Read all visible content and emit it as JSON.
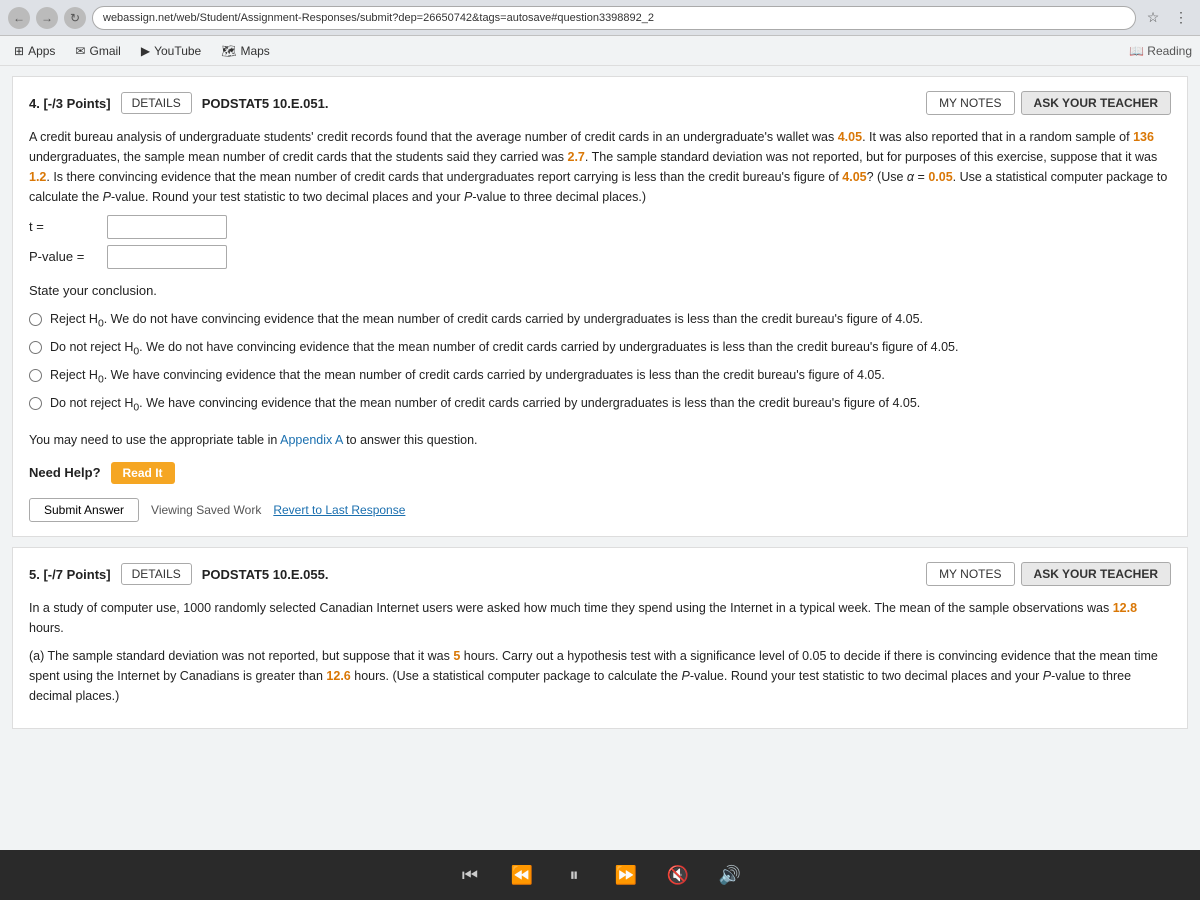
{
  "browser": {
    "url": "webassign.net/web/Student/Assignment-Responses/submit?dep=26650742&tags=autosave#question3398892_2",
    "bookmarks": [
      {
        "id": "apps",
        "label": "Apps",
        "icon": "⊞"
      },
      {
        "id": "gmail",
        "label": "Gmail",
        "icon": "✉"
      },
      {
        "id": "youtube",
        "label": "YouTube",
        "icon": "▶"
      },
      {
        "id": "maps",
        "label": "Maps",
        "icon": "🗺"
      }
    ],
    "bookmarks_right": "Reading"
  },
  "question4": {
    "points_label": "4. [-/3 Points]",
    "details_label": "DETAILS",
    "podstat_label": "PODSTAT5 10.E.051.",
    "my_notes_label": "MY NOTES",
    "ask_teacher_label": "ASK YOUR TEACHER",
    "body_text": "A credit bureau analysis of undergraduate students' credit records found that the average number of credit cards in an undergraduate's wallet was 4.05. It was also reported that in a random sample of 136 undergraduates, the sample mean number of credit cards that the students said they carried was 2.7. The sample standard deviation was not reported, but for purposes of this exercise, suppose that it was 1.2. Is there convincing evidence that the mean number of credit cards that undergraduates report carrying is less than the credit bureau's figure of 4.05? (Use α = 0.05. Use a statistical computer package to calculate the P-value. Round your test statistic to two decimal places and your P-value to three decimal places.)",
    "t_label": "t =",
    "pvalue_label": "P-value =",
    "conclusion_title": "State your conclusion.",
    "options": [
      "Reject H₀. We do not have convincing evidence that the mean number of credit cards carried by undergraduates is less than the credit bureau's figure of 4.05.",
      "Do not reject H₀. We do not have convincing evidence that the mean number of credit cards carried by undergraduates is less than the credit bureau's figure of 4.05.",
      "Reject H₀. We have convincing evidence that the mean number of credit cards carried by undergraduates is less than the credit bureau's figure of 4.05.",
      "Do not reject H₀. We have convincing evidence that the mean number of credit cards carried by undergraduates is less than the credit bureau's figure of 4.05."
    ],
    "appendix_note": "You may need to use the appropriate table in",
    "appendix_link": "Appendix A",
    "appendix_note2": "to answer this question.",
    "need_help_label": "Need Help?",
    "read_it_label": "Read It",
    "saving_status": "Viewing Saved Work",
    "revert_label": "Revert to Last Response",
    "submit_label": "Submit Answer"
  },
  "question5": {
    "points_label": "5. [-/7 Points]",
    "details_label": "DETAILS",
    "podstat_label": "PODSTAT5 10.E.055.",
    "my_notes_label": "MY NOTES",
    "ask_teacher_label": "ASK YOUR TEACHER",
    "body_intro": "In a study of computer use, 1000 randomly selected Canadian Internet users were asked how much time they spend using the Internet in a typical week. The mean of the sample observations was 12.8 hours.",
    "body_part_a": "(a) The sample standard deviation was not reported, but suppose that it was 5 hours. Carry out a hypothesis test with a significance level of 0.05 to decide if there is convincing evidence that the mean time spent using the Internet by Canadians is greater than 12.6 hours. (Use a statistical computer package to calculate the P-value. Round your test statistic to two decimal places and your P-value to three decimal places.)"
  },
  "taskbar": {
    "buttons": [
      "⏮",
      "⏪",
      "⏸",
      "⏩",
      "🔇",
      "🔊"
    ]
  }
}
